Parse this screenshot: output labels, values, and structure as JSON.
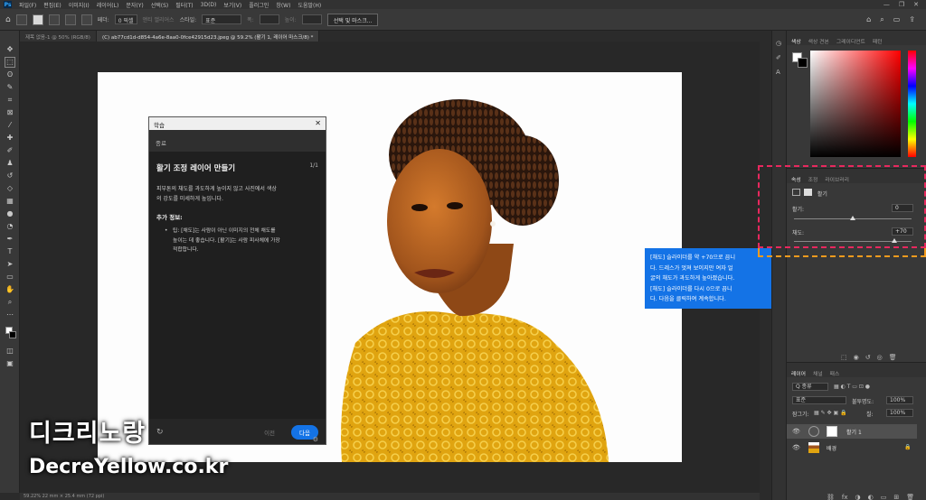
{
  "menu": {
    "logo": "Ps",
    "items": [
      "파일(F)",
      "편집(E)",
      "이미지(I)",
      "레이어(L)",
      "문자(Y)",
      "선택(S)",
      "필터(T)",
      "3D(D)",
      "보기(V)",
      "플러그인",
      "창(W)",
      "도움말(H)"
    ],
    "window_controls": [
      "—",
      "❐",
      "✕"
    ]
  },
  "options": {
    "feather_label": "페더:",
    "feather_value": "0 픽셀",
    "antialias_label": "앤티 앨리어스",
    "style_label": "스타일:",
    "style_value": "표준",
    "width_label": "폭:",
    "height_label": "높이:",
    "mask_button": "선택 및 마스크...",
    "right_icons": [
      "⌂",
      "⌕",
      "▭",
      "⇪"
    ]
  },
  "tabs": [
    {
      "label": "제목 없음-1 @ 50% (RGB/8)"
    },
    {
      "label": "(C) ab77cd1d-d854-4a6e-8aa0-0fce42915d23.jpeg @ 59.2% (활기 1, 레이어 마스크/8) *"
    }
  ],
  "tutorial": {
    "title": "학습",
    "close": "✕",
    "subheader": "종료",
    "heading": "활기 조정 레이어 만들기",
    "count": "1/1",
    "desc1": "피부톤의 채도를 과도하게 높이지 않고 사진에서 색상",
    "desc2": "의 강도를 미세하게 높입니다.",
    "info_header": "추가 정보:",
    "tip1": "팁: [채도]는 사람이 아닌 이미지의 전체 채도를",
    "tip2": "높이는 데 좋습니다. [활기]는 사람 피사체에 가장",
    "tip3": "적합합니다.",
    "refresh": "↻",
    "prev": "이전",
    "next": "다음",
    "gear": "⚙"
  },
  "watermark": {
    "line1": "디크리노랑",
    "line2": "DecreYellow.co.kr"
  },
  "callout": {
    "line1": "[채도] 슬라이더를 약 +70으로 끕니",
    "line2": "다. 드레스가 멋져 보이지만 여자 얼",
    "line3": "굴의 채도가 과도하게 높아졌습니다.",
    "line4": "[채도] 슬라이더를 다시 0으로 끕니",
    "line5": "다. 다음을 클릭하여 계속합니다."
  },
  "status": "59.22%   22 mm × 25.4 mm (72 ppi)",
  "color_panel": {
    "tabs": [
      "색상",
      "색상 견본",
      "그레이디언트",
      "패턴"
    ],
    "fg": "#ffffff",
    "bg": "#000000"
  },
  "properties": {
    "tabs": [
      "속성",
      "조정",
      "라이브러리"
    ],
    "adjustment": "활기",
    "vibrance_label": "활기:",
    "vibrance_value": "0",
    "vibrance_level": 0.5,
    "saturation_label": "채도:",
    "saturation_value": "+70",
    "saturation_level": 0.85,
    "tools": [
      "⬚",
      "◉",
      "↺",
      "◎",
      "🗑"
    ]
  },
  "layers": {
    "tabs": [
      "레이어",
      "채널",
      "패스"
    ],
    "filter": "Q 종류",
    "blend": "표준",
    "opacity_label": "불투명도:",
    "opacity": "100%",
    "lock_label": "잠그기:",
    "fill_label": "칠:",
    "fill": "100%",
    "items": [
      {
        "name": "활기 1"
      },
      {
        "name": "배경"
      }
    ],
    "tools": [
      "⛓",
      "fx",
      "◑",
      "◐",
      "▭",
      "⊞",
      "🗑"
    ]
  },
  "colors": {
    "accent": "#1473e6",
    "pink": "#e8285e",
    "orange": "#f29b1e",
    "dress": "#e0a410"
  }
}
